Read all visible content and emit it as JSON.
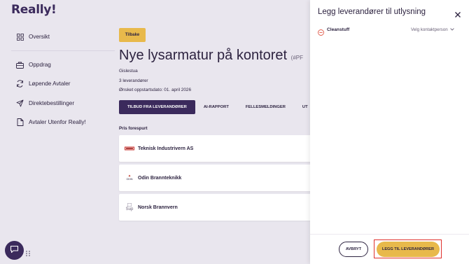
{
  "app": {
    "logo": "Really!"
  },
  "sidebar": {
    "items": [
      {
        "label": "Oversikt",
        "icon": "grid-icon"
      },
      {
        "label": "Oppdrag",
        "icon": "briefcase-icon"
      },
      {
        "label": "Løpende Avtaler",
        "icon": "refresh-icon"
      },
      {
        "label": "Direktebestillinger",
        "icon": "send-icon"
      },
      {
        "label": "Avtaler Utenfor Really!",
        "icon": "document-icon"
      }
    ]
  },
  "main": {
    "back_label": "Tilbake",
    "title": "Nye lysarmatur på kontoret",
    "title_suffix": "(#PF",
    "location": "Gislestua",
    "supplier_count": "3 leverandører",
    "start_date": "Ønsket oppstartsdato: 01. april 2026",
    "tabs": [
      {
        "label": "TILBUD FRA LEVERANDØRER",
        "active": true
      },
      {
        "label": "AI-RAPPORT",
        "active": false
      },
      {
        "label": "FELLESMELDINGER",
        "active": false
      },
      {
        "label": "UT",
        "active": false
      }
    ],
    "section_label": "Pris forespurt",
    "suppliers": [
      {
        "name": "Teknisk Industrivern AS",
        "logo_text": ""
      },
      {
        "name": "Odin Brannteknikk",
        "logo_text": "ODIN"
      },
      {
        "name": "Norsk Brannvern",
        "logo_text": "Sup"
      }
    ]
  },
  "panel": {
    "title": "Legg leverandører til utlysning",
    "selected_supplier": "Cleanstuff",
    "contact_placeholder": "Velg kontaktperson",
    "cancel_label": "AVBRYT",
    "add_label": "LEGG TIL LEVERANDØRER"
  },
  "colors": {
    "brand_dark": "#3b2a5c",
    "accent_yellow": "#e8b94b",
    "remove_red": "#e05a4a",
    "highlight_red": "#e0302c"
  }
}
